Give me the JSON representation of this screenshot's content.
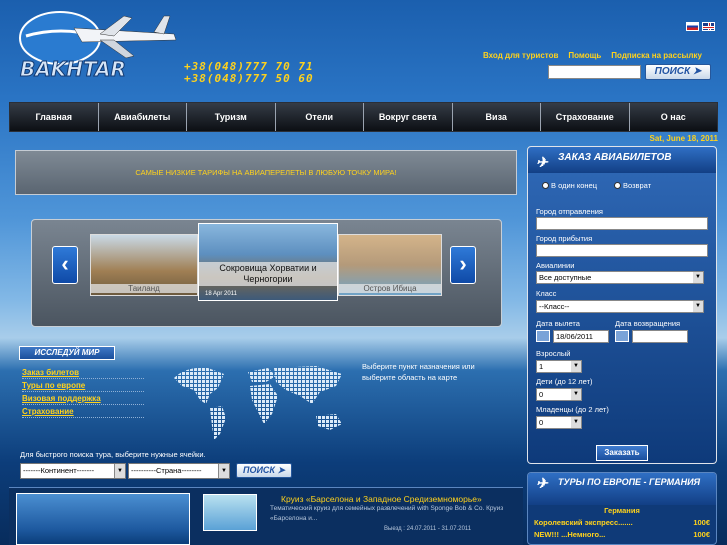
{
  "brand": {
    "name": "BAKHTAR"
  },
  "header": {
    "phones": [
      "+38(048)777 70 71",
      "+38(048)777 50 60"
    ],
    "links": [
      "Вход для туристов",
      "Помощь",
      "Подписка на рассылку"
    ],
    "search_button": "ПОИСК"
  },
  "nav": [
    "Главная",
    "Авиабилеты",
    "Туризм",
    "Отели",
    "Вокруг света",
    "Виза",
    "Страхование",
    "О нас"
  ],
  "date": "Sat, June 18, 2011",
  "banner": "САМЫЕ НИЗКИЕ ТАРИФЫ НА АВИАПЕРЕЛЕТЫ В ЛЮБУЮ ТОЧКУ МИРА!",
  "carousel": {
    "left": "Таиланд",
    "center": "Сокровища Хорватии и Черногории",
    "center_date": "18 Apr 2011",
    "right": "Остров Ибица"
  },
  "explore": {
    "title": "ИССЛЕДУЙ МИР",
    "links": [
      "Заказ билетов",
      "Туры по европе",
      "Визовая поддержка",
      "Страхование"
    ],
    "map_hint": "Выберите пункт назначения или выберите область на карте"
  },
  "quick_search": {
    "hint": "Для быстрого поиска тура, выберите нужные ячейки.",
    "continent": "-------Континент-------",
    "country": "----------Страна--------",
    "button": "ПОИСК"
  },
  "cruise": {
    "title": "Круиз «Барселона и Западное Средиземноморье»",
    "desc": "Тематический круиз для семейных развлечений with Sponge Bob & Co. Круиз «Барселона и...",
    "dates": "Выезд : 24.07.2011 - 31.07.2011"
  },
  "booking": {
    "title": "ЗАКАЗ АВИАБИЛЕТОВ",
    "oneway": "В один конец",
    "return": "Возврат",
    "from_label": "Город отправления",
    "to_label": "Город прибытия",
    "airline_label": "Авиалинии",
    "airline_value": "Все доступные",
    "class_label": "Класс",
    "class_value": "--Класс--",
    "depart_label": "Дата вылета",
    "depart_value": "18/06/2011",
    "return_label": "Дата возвращения",
    "adult_label": "Взрослый",
    "adult_value": "1",
    "child_label": "Дети (до 12 лет)",
    "child_value": "0",
    "infant_label": "Младенцы (до 2 лет)",
    "infant_value": "0",
    "submit": "Заказать"
  },
  "tours": {
    "title": "ТУРЫ ПО ЕВРОПЕ - ГЕРМАНИЯ",
    "country": "Германия",
    "items": [
      {
        "name": "Королевский экспресс.......",
        "price": "100€"
      },
      {
        "name": "NEW!!! ...Немного...",
        "price": "100€"
      }
    ]
  }
}
